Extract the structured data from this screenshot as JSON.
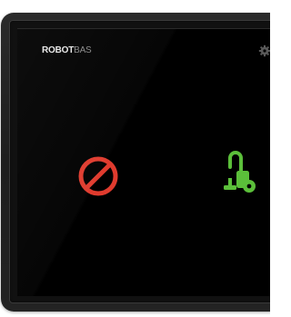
{
  "brand": {
    "bold_part": "ROBOT",
    "light_part": "BAS"
  },
  "icons": {
    "settings": "gear-icon",
    "no_entry": "no-entry-icon",
    "vacuum": "vacuum-cleaner-icon"
  },
  "colors": {
    "screen_background": "#000000",
    "no_entry": "#e03b2e",
    "vacuum": "#5bbf3a",
    "settings": "#5a5a5a",
    "brand_bold": "#e8e8e8",
    "brand_light": "#8a8a8a"
  }
}
